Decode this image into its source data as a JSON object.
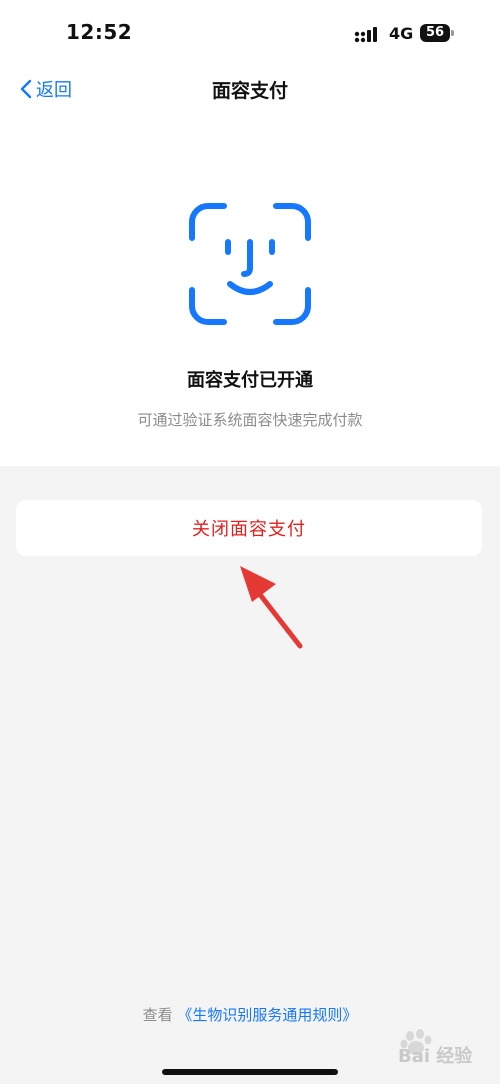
{
  "status_bar": {
    "time": "12:52",
    "network": "4G",
    "battery_level": "56"
  },
  "nav": {
    "back_label": "返回",
    "title": "面容支付"
  },
  "content": {
    "headline": "面容支付已开通",
    "subline": "可通过验证系统面容快速完成付款",
    "close_button_label": "关闭面容支付"
  },
  "footer": {
    "prefix": "查看",
    "link_text": "《生物识别服务通用规则》"
  },
  "watermark": {
    "text": "Bai 经验"
  },
  "colors": {
    "accent": "#1677ff",
    "danger": "#e02020",
    "annotation_arrow": "#e53935",
    "page_bg": "#f4f4f4"
  }
}
